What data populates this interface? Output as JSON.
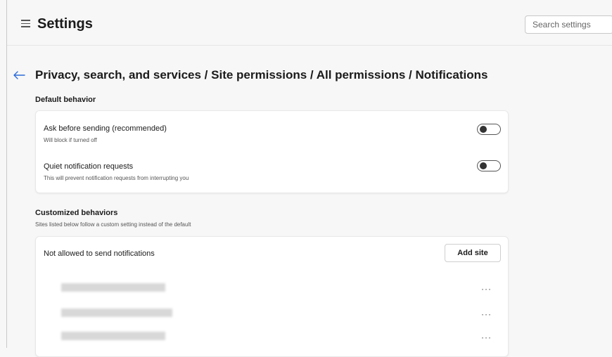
{
  "header": {
    "title": "Settings",
    "search_placeholder": "Search settings"
  },
  "breadcrumb": "Privacy, search, and services / Site permissions / All permissions / Notifications",
  "default_behavior": {
    "heading": "Default behavior",
    "items": [
      {
        "title": "Ask before sending (recommended)",
        "description": "Will block if turned off",
        "enabled": false
      },
      {
        "title": "Quiet notification requests",
        "description": "This will prevent notification requests from interrupting you",
        "enabled": false
      }
    ]
  },
  "customized_behaviors": {
    "heading": "Customized behaviors",
    "subheading": "Sites listed below follow a custom setting instead of the default",
    "blocked_list": {
      "title": "Not allowed to send notifications",
      "add_button": "Add site",
      "more_label": "···"
    }
  }
}
